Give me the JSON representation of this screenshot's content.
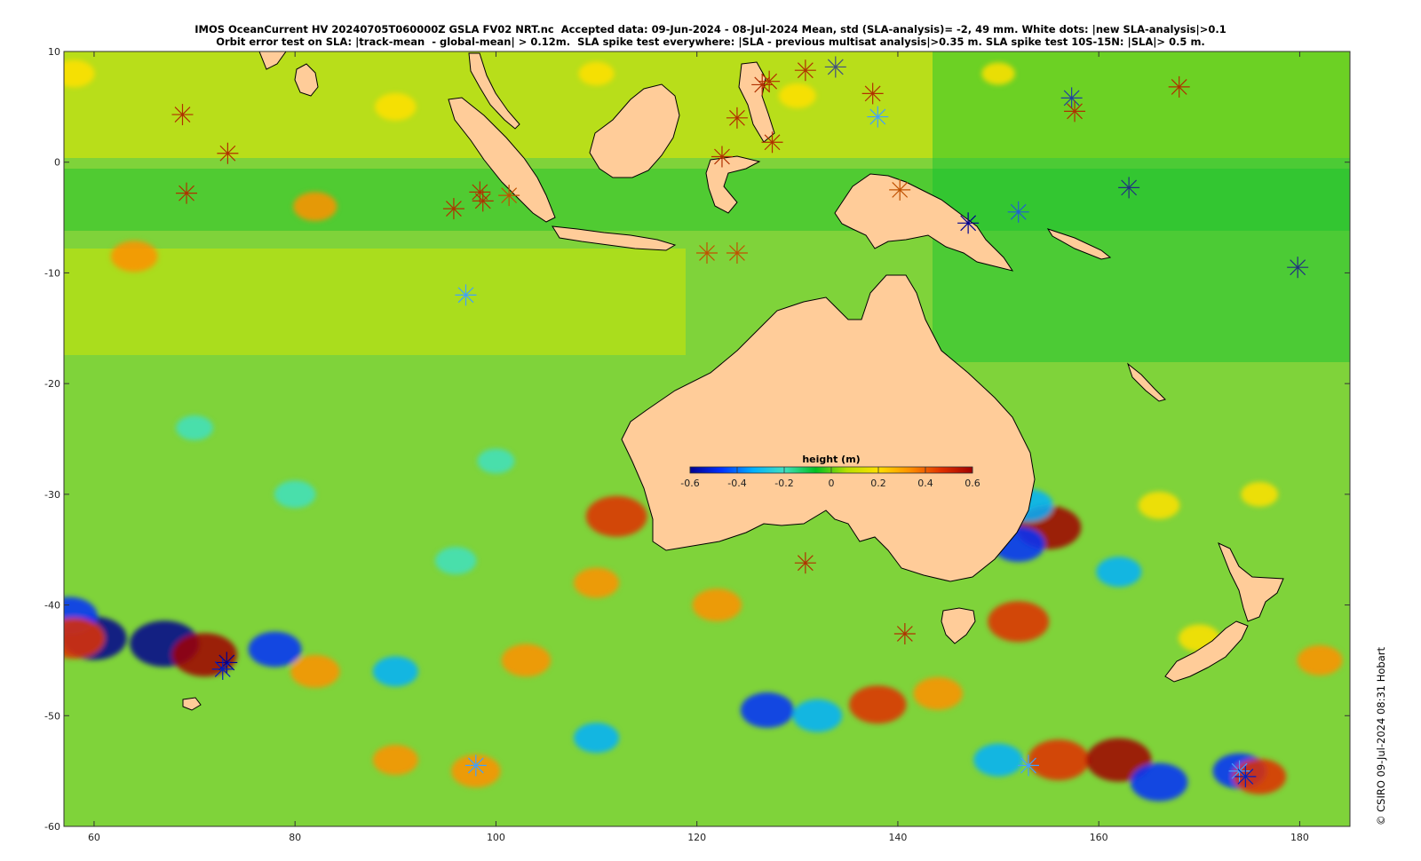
{
  "title_line1": "IMOS OceanCurrent HV 20240705T060000Z GSLA FV02 NRT.nc  Accepted data: 09-Jun-2024 - 08-Jul-2024 Mean, std (SLA-analysis)= -2, 49 mm. White dots: |new SLA-analysis|>0.1",
  "title_line2": "Orbit error test on SLA: |track-mean  - global-mean| > 0.12m.  SLA spike test everywhere: |SLA - previous multisat analysis|>0.35 m. SLA spike test 10S-15N: |SLA|> 0.5 m.",
  "credit": "© CSIRO 09-Jul-2024 08:31 Hobart",
  "colors": {
    "ocean_base": "#7fd33a",
    "land": "#ffcc99",
    "coast": "#000000"
  },
  "chart_data": {
    "type": "heatmap",
    "map_extent": {
      "lon": [
        57,
        185
      ],
      "lat": [
        -60,
        10
      ]
    },
    "x_ticks": [
      60,
      80,
      100,
      120,
      140,
      160,
      180
    ],
    "y_ticks": [
      10,
      0,
      -10,
      -20,
      -30,
      -40,
      -50,
      -60
    ],
    "colorbar": {
      "title": "height (m)",
      "range": [
        -0.6,
        0.6
      ],
      "ticks": [
        "-0.6",
        "-0.4",
        "-0.2",
        "0",
        "0.2",
        "0.4",
        "0.6"
      ],
      "stops": [
        "#00008f",
        "#0030ff",
        "#00b0ff",
        "#40e0c0",
        "#00c020",
        "#b8e000",
        "#ffe000",
        "#ff9000",
        "#e03000",
        "#a00000"
      ]
    },
    "anomalies": [
      {
        "lon": 64,
        "lat": -8.5,
        "v": 0.32
      },
      {
        "lon": 82,
        "lat": -4,
        "v": 0.28
      },
      {
        "lon": 90,
        "lat": 5,
        "v": 0.25
      },
      {
        "lon": 58,
        "lat": 8,
        "v": 0.25
      },
      {
        "lon": 110,
        "lat": 8,
        "v": 0.18
      },
      {
        "lon": 130,
        "lat": 6,
        "v": 0.2
      },
      {
        "lon": 150,
        "lat": 8,
        "v": 0.15
      },
      {
        "lon": 112,
        "lat": -32,
        "v": 0.5
      },
      {
        "lon": 155,
        "lat": -33,
        "v": 0.55
      },
      {
        "lon": 153,
        "lat": -31,
        "v": -0.35
      },
      {
        "lon": 152,
        "lat": -34.5,
        "v": -0.4
      },
      {
        "lon": 152,
        "lat": -41.5,
        "v": 0.5
      },
      {
        "lon": 67,
        "lat": -43.5,
        "v": -0.6
      },
      {
        "lon": 60,
        "lat": -43,
        "v": -0.55
      },
      {
        "lon": 57.5,
        "lat": -41,
        "v": -0.45
      },
      {
        "lon": 71,
        "lat": -44.5,
        "v": 0.55
      },
      {
        "lon": 58,
        "lat": -43,
        "v": 0.5
      },
      {
        "lon": 78,
        "lat": -44,
        "v": -0.4
      },
      {
        "lon": 82,
        "lat": -46,
        "v": 0.35
      },
      {
        "lon": 90,
        "lat": -46,
        "v": -0.3
      },
      {
        "lon": 103,
        "lat": -45,
        "v": 0.35
      },
      {
        "lon": 110,
        "lat": -38,
        "v": 0.3
      },
      {
        "lon": 122,
        "lat": -40,
        "v": 0.35
      },
      {
        "lon": 138,
        "lat": -49,
        "v": 0.45
      },
      {
        "lon": 132,
        "lat": -50,
        "v": -0.35
      },
      {
        "lon": 127,
        "lat": -49.5,
        "v": -0.4
      },
      {
        "lon": 144,
        "lat": -48,
        "v": 0.35
      },
      {
        "lon": 150,
        "lat": -54,
        "v": -0.35
      },
      {
        "lon": 156,
        "lat": -54,
        "v": 0.5
      },
      {
        "lon": 162,
        "lat": -54,
        "v": 0.55
      },
      {
        "lon": 166,
        "lat": -56,
        "v": -0.45
      },
      {
        "lon": 174,
        "lat": -55,
        "v": -0.4
      },
      {
        "lon": 176,
        "lat": -55.5,
        "v": 0.4
      },
      {
        "lon": 182,
        "lat": -45,
        "v": 0.3
      },
      {
        "lon": 98,
        "lat": -55,
        "v": 0.35
      },
      {
        "lon": 90,
        "lat": -54,
        "v": 0.3
      },
      {
        "lon": 110,
        "lat": -52,
        "v": -0.3
      },
      {
        "lon": 162,
        "lat": -37,
        "v": -0.3
      },
      {
        "lon": 166,
        "lat": -31,
        "v": 0.25
      },
      {
        "lon": 80,
        "lat": -30,
        "v": -0.25
      },
      {
        "lon": 96,
        "lat": -36,
        "v": -0.25
      },
      {
        "lon": 100,
        "lat": -27,
        "v": -0.2
      },
      {
        "lon": 70,
        "lat": -24,
        "v": -0.2
      },
      {
        "lon": 176,
        "lat": -30,
        "v": 0.2
      },
      {
        "lon": 170,
        "lat": -43,
        "v": 0.25
      }
    ],
    "markers": [
      {
        "lon": 68.8,
        "lat": 4.3,
        "c": "#b03000"
      },
      {
        "lon": 73.3,
        "lat": 0.8,
        "c": "#b03000"
      },
      {
        "lon": 69.2,
        "lat": -2.8,
        "c": "#b03000"
      },
      {
        "lon": 95.8,
        "lat": -4.2,
        "c": "#b03000"
      },
      {
        "lon": 98.4,
        "lat": -2.7,
        "c": "#b03000"
      },
      {
        "lon": 98.7,
        "lat": -3.5,
        "c": "#b03000"
      },
      {
        "lon": 101.3,
        "lat": -3.0,
        "c": "#c05000"
      },
      {
        "lon": 97.0,
        "lat": -12.0,
        "c": "#40a0ff"
      },
      {
        "lon": 126.5,
        "lat": 7.0,
        "c": "#b03000"
      },
      {
        "lon": 127.2,
        "lat": 7.3,
        "c": "#b03000"
      },
      {
        "lon": 130.8,
        "lat": 8.3,
        "c": "#b03000"
      },
      {
        "lon": 133.8,
        "lat": 8.6,
        "c": "#405080"
      },
      {
        "lon": 124.0,
        "lat": 4.0,
        "c": "#b03000"
      },
      {
        "lon": 127.5,
        "lat": 1.8,
        "c": "#b03000"
      },
      {
        "lon": 122.5,
        "lat": 0.5,
        "c": "#b03000"
      },
      {
        "lon": 137.5,
        "lat": 6.2,
        "c": "#b03000"
      },
      {
        "lon": 138.0,
        "lat": 4.1,
        "c": "#40a0ff"
      },
      {
        "lon": 140.2,
        "lat": -2.5,
        "c": "#c05000"
      },
      {
        "lon": 147.0,
        "lat": -5.5,
        "c": "#000090"
      },
      {
        "lon": 152.0,
        "lat": -4.5,
        "c": "#2060d0"
      },
      {
        "lon": 157.3,
        "lat": 5.8,
        "c": "#2040a0"
      },
      {
        "lon": 157.6,
        "lat": 4.6,
        "c": "#b03000"
      },
      {
        "lon": 163.0,
        "lat": -2.3,
        "c": "#203080"
      },
      {
        "lon": 168.0,
        "lat": 6.8,
        "c": "#b03000"
      },
      {
        "lon": 179.8,
        "lat": -9.5,
        "c": "#203080"
      },
      {
        "lon": 130.8,
        "lat": -36.2,
        "c": "#b03000"
      },
      {
        "lon": 140.7,
        "lat": -42.6,
        "c": "#b03000"
      },
      {
        "lon": 73.2,
        "lat": -45.2,
        "c": "#000090"
      },
      {
        "lon": 72.8,
        "lat": -45.8,
        "c": "#0020c0"
      },
      {
        "lon": 98.0,
        "lat": -54.5,
        "c": "#40a0ff"
      },
      {
        "lon": 174.0,
        "lat": -55.0,
        "c": "#40a0ff"
      },
      {
        "lon": 174.6,
        "lat": -55.5,
        "c": "#0020c0"
      },
      {
        "lon": 153.0,
        "lat": -54.5,
        "c": "#40a0ff"
      },
      {
        "lon": 121.0,
        "lat": -8.2,
        "c": "#c05000"
      },
      {
        "lon": 124.0,
        "lat": -8.2,
        "c": "#c05000"
      }
    ]
  }
}
